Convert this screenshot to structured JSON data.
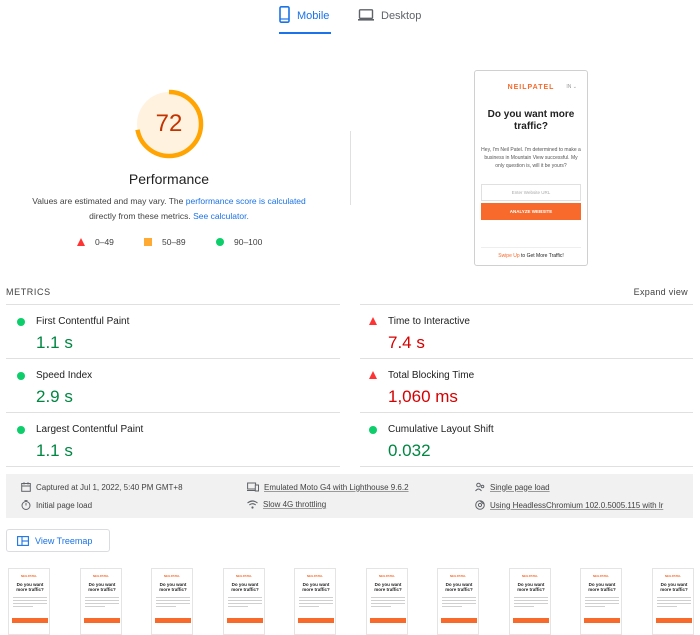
{
  "tabs": [
    {
      "label": "Mobile",
      "icon": "smartphone-icon",
      "active": true
    },
    {
      "label": "Desktop",
      "icon": "monitor-icon",
      "active": false
    }
  ],
  "score": {
    "value": "72",
    "fraction": 0.72,
    "title": "Performance",
    "note_before": "Values are estimated and may vary. The ",
    "note_link1": "performance score is calculated",
    "note_middle": " directly from these metrics. ",
    "note_link2": "See calculator.",
    "legend": [
      {
        "range": "0–49",
        "shape": "triangle",
        "color": "#ff3333"
      },
      {
        "range": "50–89",
        "shape": "square",
        "color": "#ffaa33"
      },
      {
        "range": "90–100",
        "shape": "circle",
        "color": "#0cce6b"
      }
    ],
    "ring_color": "#ffa400",
    "ring_track": "#fff3e0"
  },
  "screenshot": {
    "brand": "NEILPATEL",
    "brand_extra": "IN ⌄",
    "headline": "Do you want more traffic?",
    "body": "Hey, I'm Neil Patel. I'm determined to make a business in Mountain View successful. My only question is, will it be yours?",
    "url_placeholder": "Enter Website URL",
    "button": "ANALYZE WEBSITE",
    "swipe_highlight": "Swipe Up",
    "swipe_rest": " to Get More Traffic!"
  },
  "metrics": {
    "heading": "METRICS",
    "expand": "Expand view",
    "items": [
      {
        "name": "First Contentful Paint",
        "value": "1.1 s",
        "status": "good"
      },
      {
        "name": "Time to Interactive",
        "value": "7.4 s",
        "status": "bad"
      },
      {
        "name": "Speed Index",
        "value": "2.9 s",
        "status": "good"
      },
      {
        "name": "Total Blocking Time",
        "value": "1,060 ms",
        "status": "bad"
      },
      {
        "name": "Largest Contentful Paint",
        "value": "1.1 s",
        "status": "good"
      },
      {
        "name": "Cumulative Layout Shift",
        "value": "0.032",
        "status": "good"
      }
    ]
  },
  "runtime": {
    "captured": "Captured at Jul 1, 2022, 5:40 PM GMT+8",
    "emulated": "Emulated Moto G4 with Lighthouse 9.6.2",
    "single": "Single page load",
    "initial": "Initial page load",
    "throttling": "Slow 4G throttling",
    "browser": "Using HeadlessChromium 102.0.5005.115 with lr"
  },
  "treemap": {
    "label": "View Treemap"
  },
  "filmstrip": {
    "count": 10,
    "brand": "NEILPATEL",
    "headline": "Do you want more traffic?"
  }
}
